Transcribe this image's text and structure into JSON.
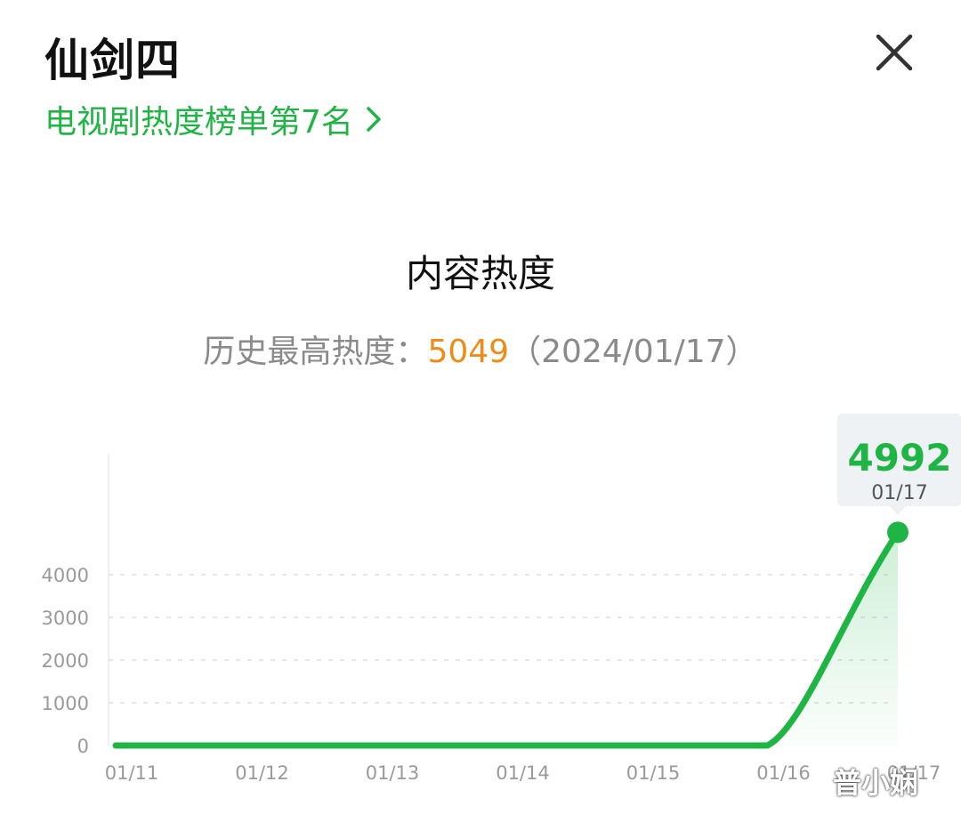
{
  "header": {
    "title": "仙剑四",
    "rank_link": "电视剧热度榜单第7名",
    "close_icon": "close-icon",
    "chevron_icon": "chevron-right-icon"
  },
  "section_title": "内容热度",
  "peak": {
    "label": "历史最高热度：",
    "value": "5049",
    "date": "（2024/01/17）"
  },
  "tooltip": {
    "value": "4992",
    "date": "01/17"
  },
  "watermark": "普小娴",
  "colors": {
    "accent": "#1fb545",
    "peak": "#f08c16",
    "muted": "#8a8a8a"
  },
  "chart_data": {
    "type": "area",
    "x": [
      "01/11",
      "01/12",
      "01/13",
      "01/14",
      "01/15",
      "01/16",
      "01/17"
    ],
    "series": [
      {
        "values": [
          0,
          0,
          0,
          0,
          0,
          0,
          4992
        ]
      }
    ],
    "yticks": [
      0,
      1000,
      2000,
      3000,
      4000
    ],
    "ylim": [
      0,
      4000
    ],
    "grid": true,
    "xlabel": "",
    "ylabel": ""
  }
}
